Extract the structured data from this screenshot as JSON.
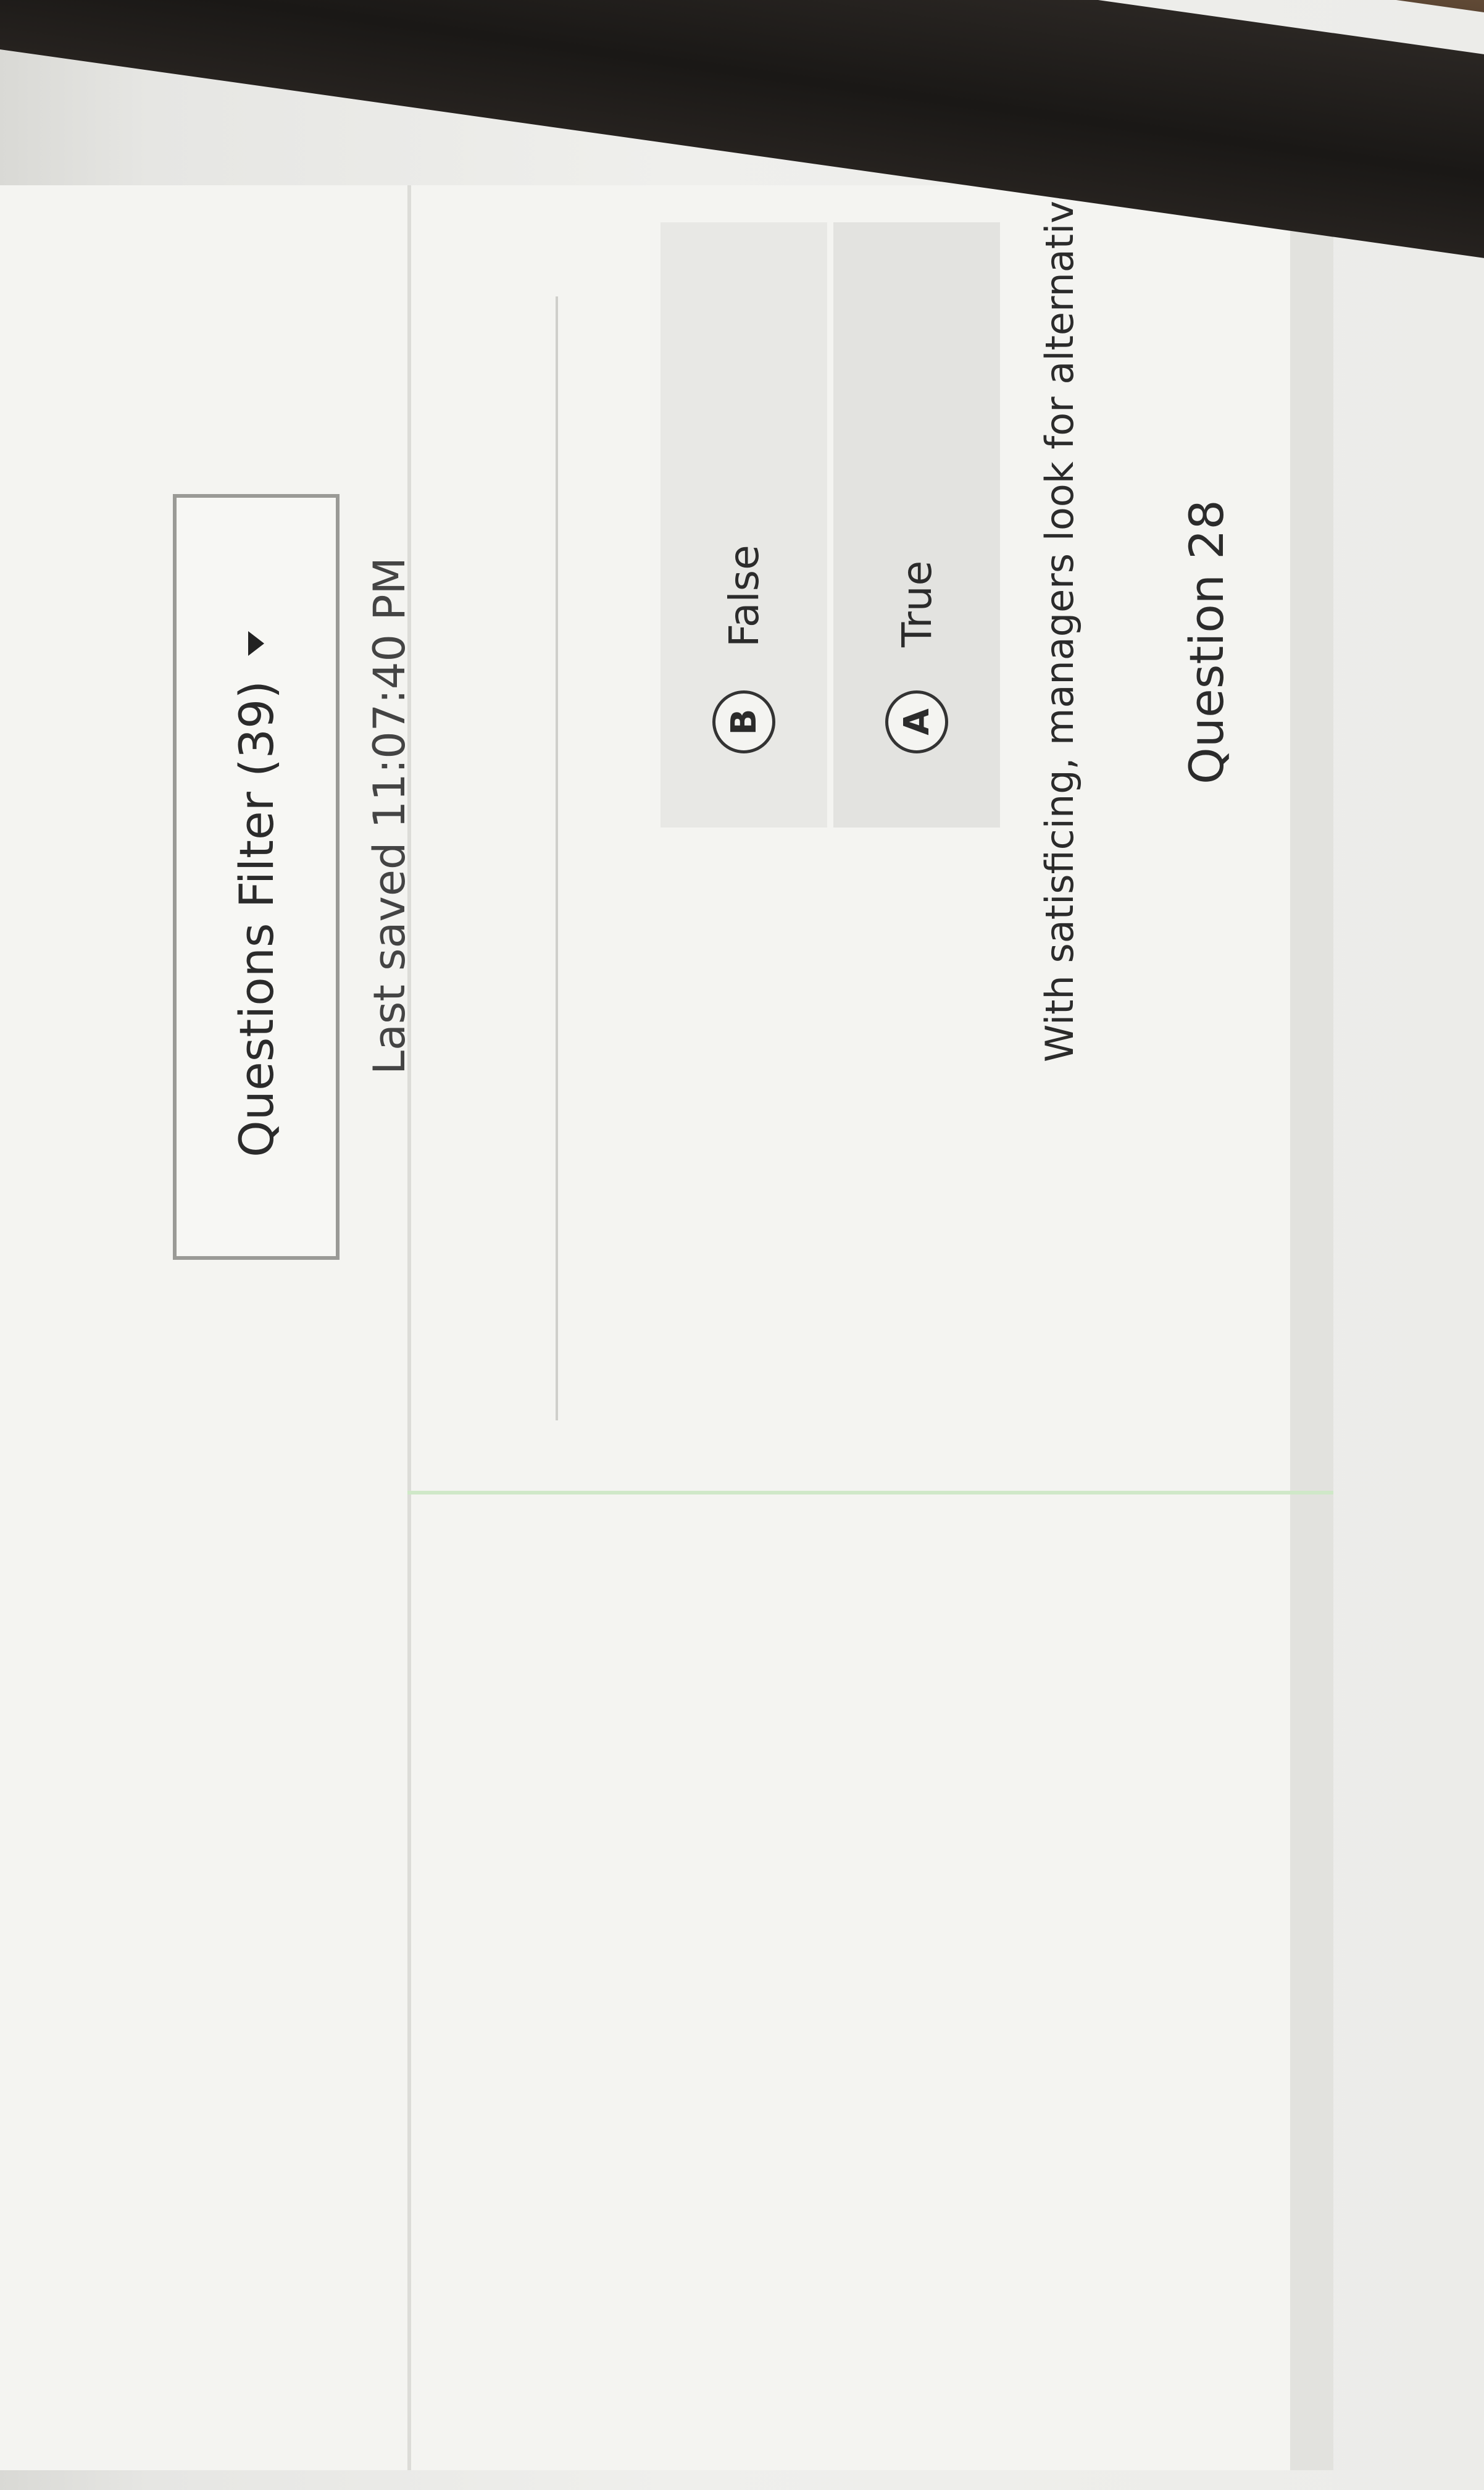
{
  "question": {
    "title": "Question 28",
    "text": "With satisficing, managers look for alternatives until they find one that is satisfactory"
  },
  "answers": [
    {
      "badge": "A",
      "label": "True"
    },
    {
      "badge": "B",
      "label": "False"
    }
  ],
  "status": {
    "last_saved": "Last saved 11:07:40 PM"
  },
  "filter": {
    "label": "Questions Filter (39)",
    "icon": "chevron-down-icon"
  }
}
